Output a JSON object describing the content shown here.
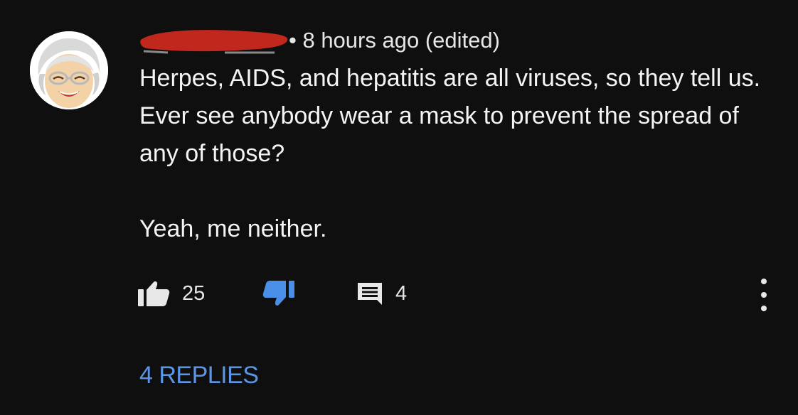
{
  "comment": {
    "timestamp": "• 8 hours ago (edited)",
    "body_paragraph_1": "Herpes, AIDS, and hepatitis are all viruses, so they tell us. Ever see anybody wear a mask to prevent the spread of any of those?",
    "body_paragraph_2": "Yeah, me neither.",
    "like_count": "25",
    "reply_count": "4",
    "replies_label": "4 REPLIES"
  },
  "icons": {
    "like": "thumbs-up-icon",
    "dislike": "thumbs-down-icon",
    "reply": "comment-icon",
    "more": "more-vertical-icon"
  },
  "colors": {
    "background": "#0f0f0f",
    "text": "#f1f1f1",
    "accent_blue": "#5a95e6",
    "dislike_active": "#4a8fe7",
    "redaction": "#c0281e"
  }
}
